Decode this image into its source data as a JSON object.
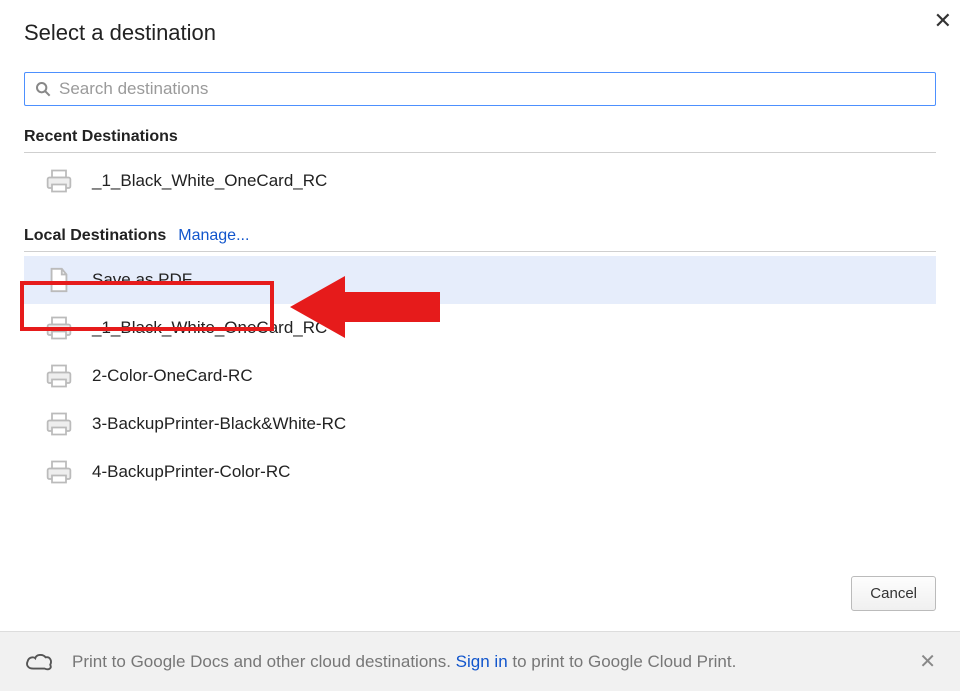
{
  "title": "Select a destination",
  "search": {
    "placeholder": "Search destinations"
  },
  "recent": {
    "heading": "Recent Destinations",
    "items": [
      {
        "label": "_1_Black_White_OneCard_RC",
        "icon": "printer"
      }
    ]
  },
  "local": {
    "heading": "Local Destinations",
    "manage_label": "Manage...",
    "items": [
      {
        "label": "Save as PDF",
        "icon": "document",
        "selected": true
      },
      {
        "label": "_1_Black_White_OneCard_RC",
        "icon": "printer"
      },
      {
        "label": "2-Color-OneCard-RC",
        "icon": "printer"
      },
      {
        "label": "3-BackupPrinter-Black&White-RC",
        "icon": "printer"
      },
      {
        "label": "4-BackupPrinter-Color-RC",
        "icon": "printer"
      }
    ]
  },
  "footer": {
    "text_before": "Print to Google Docs and other cloud destinations. ",
    "signin": "Sign in",
    "text_after": " to print to Google Cloud Print."
  },
  "cancel_label": "Cancel"
}
